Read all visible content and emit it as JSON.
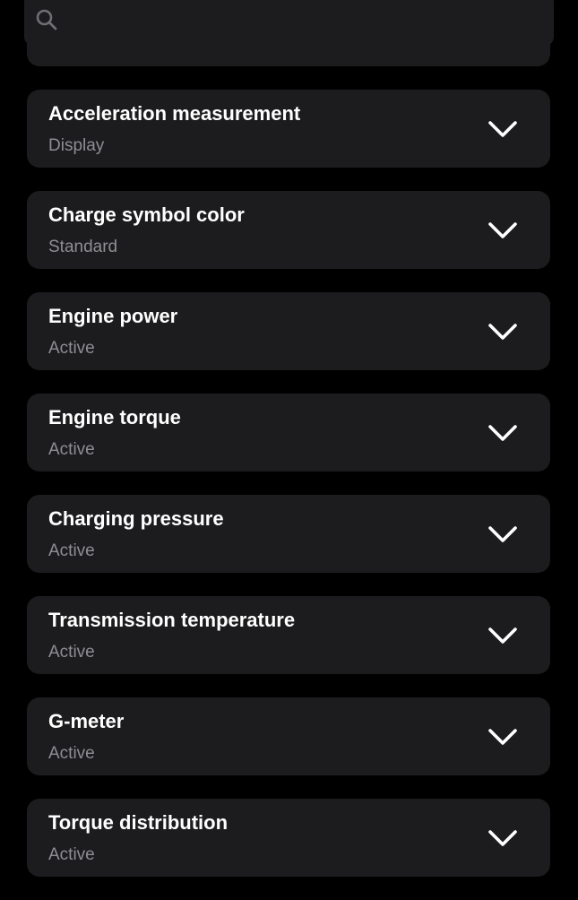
{
  "search": {
    "placeholder": "",
    "icon": "search-icon"
  },
  "settings": [
    {
      "title": "Acceleration measurement",
      "value": "Display"
    },
    {
      "title": "Charge symbol color",
      "value": "Standard"
    },
    {
      "title": "Engine power",
      "value": "Active"
    },
    {
      "title": "Engine torque",
      "value": "Active"
    },
    {
      "title": "Charging pressure",
      "value": "Active"
    },
    {
      "title": "Transmission temperature",
      "value": "Active"
    },
    {
      "title": "G-meter",
      "value": "Active"
    },
    {
      "title": "Torque distribution",
      "value": "Active"
    }
  ],
  "colors": {
    "background": "#000000",
    "card": "#1c1c1e",
    "title": "#ffffff",
    "subtitle": "#8e8e93",
    "icon": "#ffffff",
    "search_icon": "#6e6e73"
  },
  "icons": {
    "expand": "chevron-down-icon"
  }
}
